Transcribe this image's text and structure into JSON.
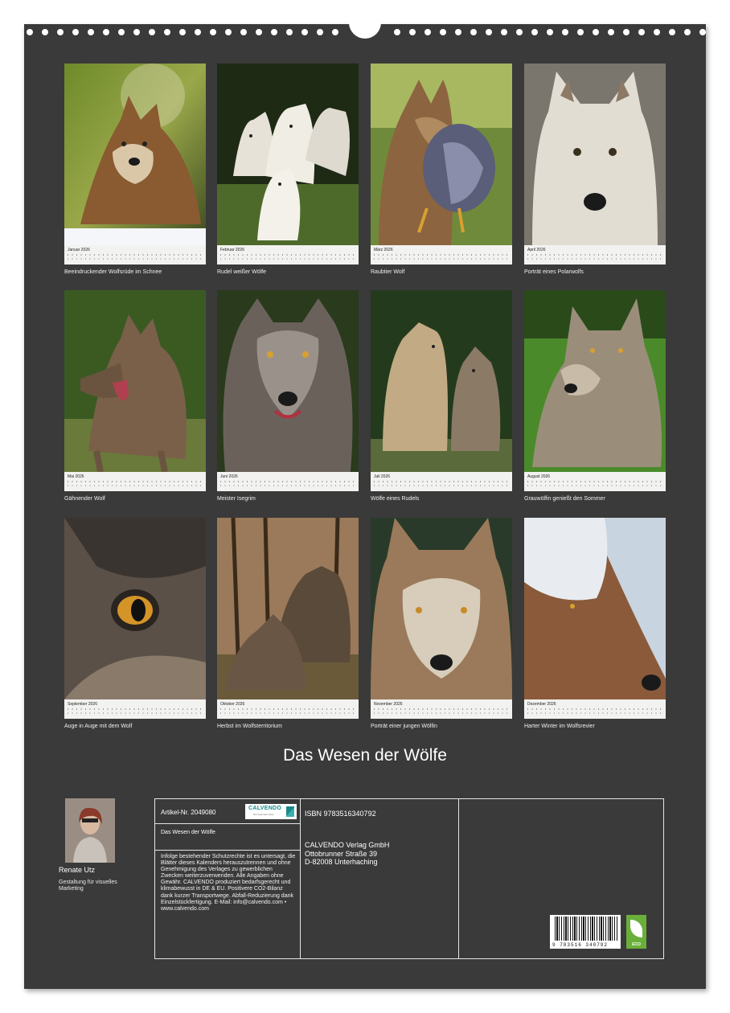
{
  "months": [
    {
      "month_label": "Januar 2026",
      "caption": "Beeindruckender Wolfsrüde im Schnee"
    },
    {
      "month_label": "Februar 2026",
      "caption": "Rudel weißer Wölfe"
    },
    {
      "month_label": "März 2026",
      "caption": "Raubtier Wolf"
    },
    {
      "month_label": "April 2026",
      "caption": "Porträt eines Polarwolfs"
    },
    {
      "month_label": "Mai 2026",
      "caption": "Gähnender Wolf"
    },
    {
      "month_label": "Juni 2026",
      "caption": "Meister Isegrim"
    },
    {
      "month_label": "Juli 2026",
      "caption": "Wölfe eines Rudels"
    },
    {
      "month_label": "August 2026",
      "caption": "Grauwölfin genießt den Sommer"
    },
    {
      "month_label": "September 2026",
      "caption": "Auge in Auge mit dem Wolf"
    },
    {
      "month_label": "Oktober 2026",
      "caption": "Herbst im Wolfsterritorium"
    },
    {
      "month_label": "November 2026",
      "caption": "Porträt einer jungen Wölfin"
    },
    {
      "month_label": "Dezember 2026",
      "caption": "Harter Winter im Wolfsrevier"
    }
  ],
  "calendar_title": "Das Wesen der Wölfe",
  "author": {
    "name": "Renate Utz",
    "role": "Gestaltung für visuelles Marketing"
  },
  "info": {
    "article_number": "Artikel-Nr. 2049080",
    "logo_brand": "CALVENDO",
    "logo_sub": "Die Kalendermarke",
    "short_title": "Das Wesen der Wölfe",
    "legal_text": "Infolge bestehender Schutzrechte ist es untersagt, die Blätter dieses Kalenders herauszutrennen und ohne Genehmigung des Verlages zu gewerblichen Zwecken weiterzuverwenden. Alle Angaben ohne Gewähr. CALVENDO produziert bedarfsgerecht und klimabewusst in DE & EU. Positivere CO2-Bilanz dank kurzer Transportwege. Abfall-Reduzierung dank Einzelstückfertigung. E-Mail: info@calvendo.com • www.calvendo.com",
    "isbn": "ISBN 9783516340792",
    "publisher_name": "CALVENDO Verlag GmbH",
    "publisher_street": "Ottobrunner Straße 39",
    "publisher_city": "D-82008 Unterhaching",
    "barcode_digits": "9 783516 340792",
    "eco_label": "ECO"
  },
  "colors": {
    "sheet_background": "#3a3a3a",
    "calendar_strip": "#f2f2f0",
    "eco_green": "#6aaf3a",
    "calvendo_teal": "#1b8a8a"
  }
}
